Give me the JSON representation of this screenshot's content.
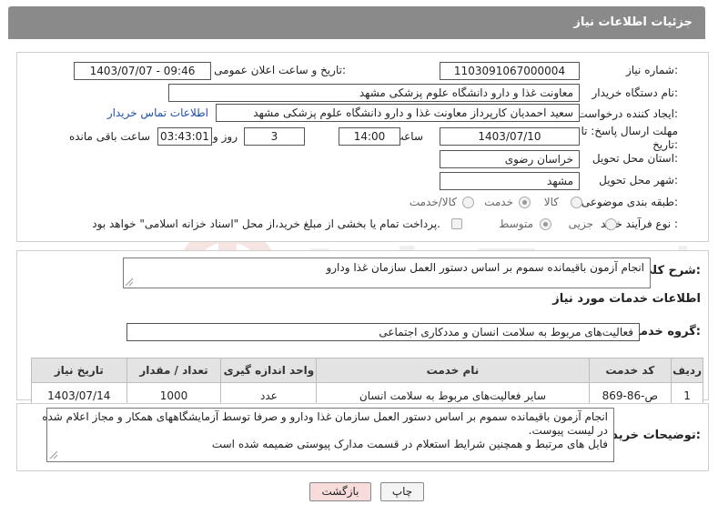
{
  "header": {
    "title": "جزئیات اطلاعات نیاز"
  },
  "form": {
    "need_number": {
      "label": "شماره نیاز:",
      "value": "1103091067000004"
    },
    "announce": {
      "label": "تاریخ و ساعت اعلان عمومی:",
      "value": "1403/07/07 - 09:46"
    },
    "buyer_org": {
      "label": "نام دستگاه خریدار:",
      "value": "معاونت غذا و دارو دانشگاه علوم پزشکی مشهد"
    },
    "creator": {
      "label": "ایجاد کننده درخواست:",
      "value": "سعید احمدیان کارپرداز معاونت غذا و دارو دانشگاه علوم پزشکی مشهد",
      "contact_link": "اطلاعات تماس خریدار"
    },
    "deadline": {
      "label_line1": "مهلت ارسال پاسخ: تا",
      "label_line2": "تاریخ:",
      "date": "1403/07/10",
      "time_label": "ساعت",
      "time": "14:00",
      "days": "3",
      "days_label": "روز و",
      "remaining": "03:43:01",
      "remaining_label": "ساعت باقی مانده"
    },
    "province": {
      "label": "استان محل تحویل:",
      "value": "خراسان رضوی"
    },
    "city": {
      "label": "شهر محل تحویل:",
      "value": "مشهد"
    },
    "category": {
      "label": "طبقه بندی موضوعی:",
      "options": [
        "کالا",
        "خدمت",
        "کالا/خدمت"
      ],
      "selected": "خدمت"
    },
    "purchase": {
      "label": "نوع فرآیند خرید :",
      "options": [
        "جزیی",
        "متوسط"
      ],
      "selected": "متوسط",
      "checkbox_text": "پرداخت تمام یا بخشی از مبلغ خرید،از محل \"اسناد خزانه اسلامی\" خواهد بود."
    }
  },
  "summary": {
    "label": "شرح کلی نیاز:",
    "value": "انجام آزمون باقیمانده سموم بر اساس دستور العمل سازمان غذا ودارو"
  },
  "services": {
    "section_title": "اطلاعات خدمات مورد نیاز",
    "group_label": "گروه خدمت:",
    "group_value": "فعالیت‌های مربوط به سلامت انسان و مددکاری اجتماعی",
    "columns": [
      "ردیف",
      "کد خدمت",
      "نام خدمت",
      "واحد اندازه گیری",
      "تعداد / مقدار",
      "تاریخ نیاز"
    ],
    "rows": [
      {
        "row": "1",
        "code": "ص-86-869",
        "name": "سایر فعالیت‌های مربوط به سلامت انسان",
        "unit": "عدد",
        "qty": "1000",
        "date": "1403/07/14"
      }
    ]
  },
  "buyer_notes": {
    "label": "توضیحات خریدار:",
    "line1": "انجام آزمون باقیمانده سموم بر اساس دستور العمل سازمان غذا ودارو و صرفا توسط آزمایشگاههای همکار و مجاز اعلام  شده",
    "line2": "در لیست  پیوست.",
    "line3": "فایل های مرتبط و همچنین شرایط استعلام در قسمت مدارک پیوستی ضمیمه شده است"
  },
  "buttons": {
    "print": "چاپ",
    "back": "بازگشت"
  },
  "colors": {
    "header_bg": "#8a8a8a",
    "back_btn_bg": "#f8dcdc",
    "table_header_bg": "#e3e3e3",
    "link": "#1f4fa8"
  }
}
